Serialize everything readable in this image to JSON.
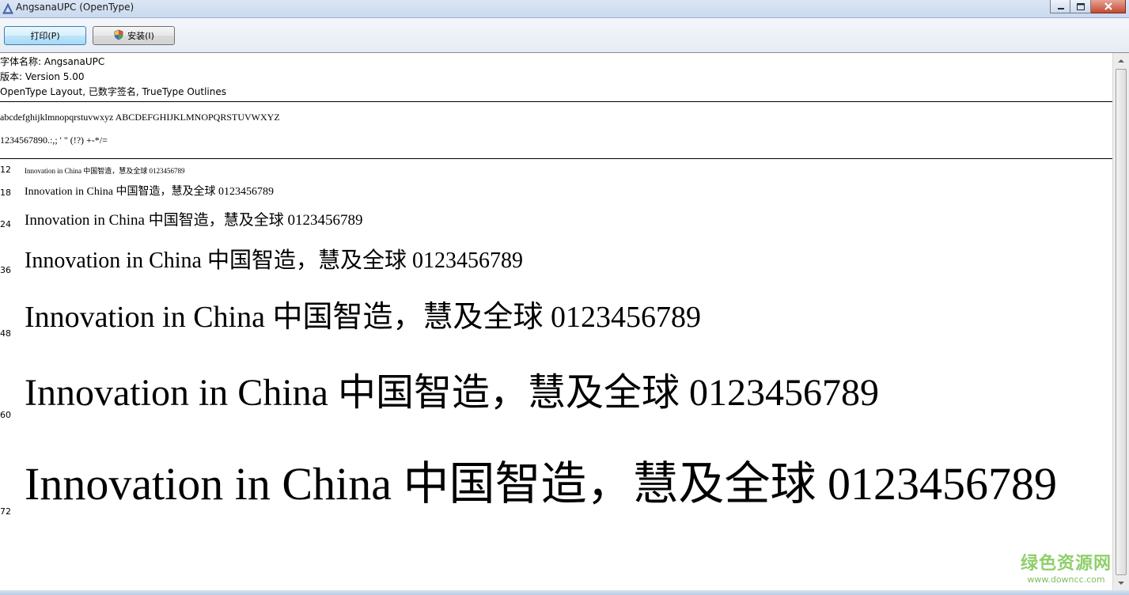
{
  "window": {
    "title": "AngsanaUPC (OpenType)"
  },
  "toolbar": {
    "print_label": "打印(P)",
    "install_label": "安装(I)"
  },
  "font_info": {
    "name_line": "字体名称: AngsanaUPC",
    "version_line": "版本: Version 5.00",
    "type_line": "OpenType Layout, 已数字签名, TrueType Outlines"
  },
  "charset": {
    "letters": "abcdefghijklmnopqrstuvwxyz ABCDEFGHIJKLMNOPQRSTUVWXYZ",
    "digits": "1234567890.:,; ' \" (!?) +-*/="
  },
  "samples": [
    {
      "size": "12",
      "text": "Innovation in China 中国智造，慧及全球 0123456789"
    },
    {
      "size": "18",
      "text": "Innovation in China 中国智造，慧及全球 0123456789"
    },
    {
      "size": "24",
      "text": "Innovation in China 中国智造，慧及全球 0123456789"
    },
    {
      "size": "36",
      "text": "Innovation in China 中国智造，慧及全球 0123456789"
    },
    {
      "size": "48",
      "text": "Innovation in China 中国智造，慧及全球 0123456789"
    },
    {
      "size": "60",
      "text": "Innovation in China 中国智造，慧及全球 0123456789"
    },
    {
      "size": "72",
      "text": "Innovation in China 中国智造，慧及全球 0123456789"
    }
  ],
  "watermark": {
    "main": "绿色资源网",
    "sub": "www.downcc.com"
  },
  "colors": {
    "watermark_green": "#8ecf6a",
    "titlebar": "#c9d9ee"
  },
  "icons": {
    "app": "font-app-icon",
    "install": "uac-shield-icon",
    "minimize": "minimize-icon",
    "maximize": "maximize-icon",
    "close": "close-icon"
  }
}
